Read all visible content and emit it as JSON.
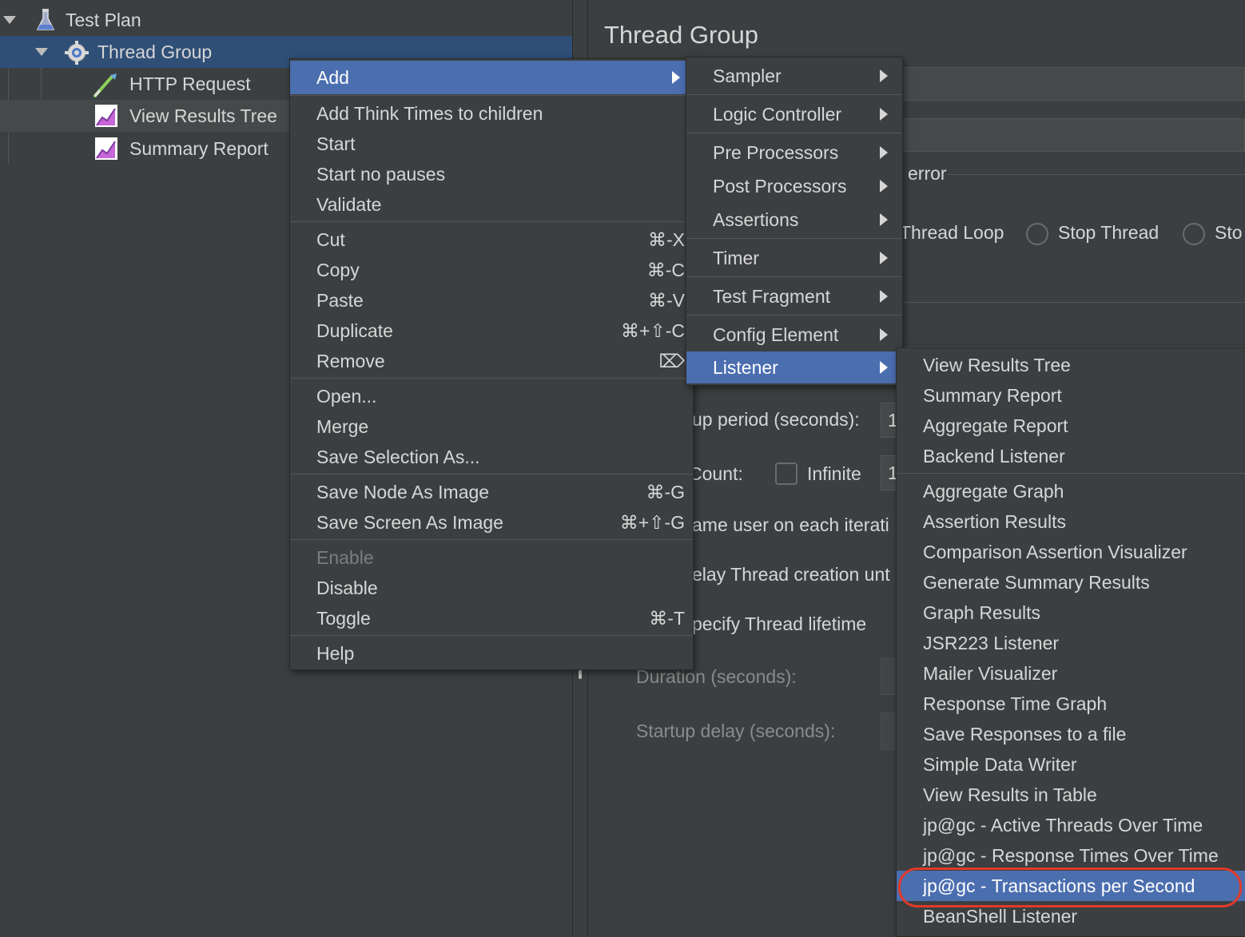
{
  "tree": {
    "items": [
      {
        "label": "Test Plan",
        "icon": "flask-icon"
      },
      {
        "label": "Thread Group",
        "icon": "gear-icon"
      },
      {
        "label": "HTTP Request",
        "icon": "pipette-icon"
      },
      {
        "label": "View Results Tree",
        "icon": "chart-icon"
      },
      {
        "label": "Summary Report",
        "icon": "chart-icon"
      }
    ]
  },
  "panel": {
    "title": "Thread Group",
    "error_label": "error",
    "radio_thread_loop": "Thread Loop",
    "radio_stop_thread": "Stop Thread",
    "radio_stop_test": "Sto",
    "rampup_label": "up period (seconds):",
    "rampup_value": "1",
    "loop_label": "Count:",
    "infinite_label": "Infinite",
    "loop_value": "1",
    "same_user_label": "ame user on each iterati",
    "delay_label": "elay Thread creation unt",
    "lifetime_label": "pecify Thread lifetime",
    "duration_label": "Duration (seconds):",
    "startup_label": "Startup delay (seconds):"
  },
  "context_menu": {
    "items": [
      {
        "label": "Add",
        "shortcut": "",
        "highlighted": true,
        "submenu": true
      },
      {
        "label": "Add Think Times to children",
        "shortcut": ""
      },
      {
        "label": "Start",
        "shortcut": ""
      },
      {
        "label": "Start no pauses",
        "shortcut": ""
      },
      {
        "label": "Validate",
        "shortcut": ""
      },
      {
        "label": "Cut",
        "shortcut": "⌘-X"
      },
      {
        "label": "Copy",
        "shortcut": "⌘-C"
      },
      {
        "label": "Paste",
        "shortcut": "⌘-V"
      },
      {
        "label": "Duplicate",
        "shortcut": "⌘+⇧-C"
      },
      {
        "label": "Remove",
        "shortcut": "⌦"
      },
      {
        "label": "Open...",
        "shortcut": ""
      },
      {
        "label": "Merge",
        "shortcut": ""
      },
      {
        "label": "Save Selection As...",
        "shortcut": ""
      },
      {
        "label": "Save Node As Image",
        "shortcut": "⌘-G"
      },
      {
        "label": "Save Screen As Image",
        "shortcut": "⌘+⇧-G"
      },
      {
        "label": "Enable",
        "shortcut": "",
        "disabled": true
      },
      {
        "label": "Disable",
        "shortcut": ""
      },
      {
        "label": "Toggle",
        "shortcut": "⌘-T"
      },
      {
        "label": "Help",
        "shortcut": ""
      }
    ]
  },
  "add_submenu": {
    "items": [
      {
        "label": "Sampler"
      },
      {
        "label": "Logic Controller"
      },
      {
        "label": "Pre Processors"
      },
      {
        "label": "Post Processors"
      },
      {
        "label": "Assertions"
      },
      {
        "label": "Timer"
      },
      {
        "label": "Test Fragment"
      },
      {
        "label": "Config Element"
      },
      {
        "label": "Listener",
        "highlighted": true
      }
    ]
  },
  "listener_submenu": {
    "items": [
      {
        "label": "View Results Tree"
      },
      {
        "label": "Summary Report"
      },
      {
        "label": "Aggregate Report"
      },
      {
        "label": "Backend Listener"
      },
      {
        "label": "Aggregate Graph"
      },
      {
        "label": "Assertion Results"
      },
      {
        "label": "Comparison Assertion Visualizer"
      },
      {
        "label": "Generate Summary Results"
      },
      {
        "label": "Graph Results"
      },
      {
        "label": "JSR223 Listener"
      },
      {
        "label": "Mailer Visualizer"
      },
      {
        "label": "Response Time Graph"
      },
      {
        "label": "Save Responses to a file"
      },
      {
        "label": "Simple Data Writer"
      },
      {
        "label": "View Results in Table"
      },
      {
        "label": "jp@gc - Active Threads Over Time"
      },
      {
        "label": "jp@gc - Response Times Over Time"
      },
      {
        "label": "jp@gc - Transactions per Second",
        "highlighted": true,
        "circled": true
      },
      {
        "label": "BeanShell Listener"
      }
    ]
  },
  "colors": {
    "background": "#3c3f41",
    "highlight": "#4b6eaf",
    "tree_selection": "#2f4f77",
    "annotation_ring": "#e03a2a"
  }
}
